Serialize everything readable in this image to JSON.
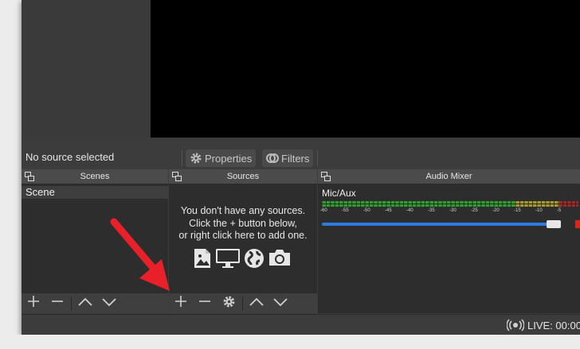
{
  "context_bar": {
    "status": "No source selected",
    "properties_label": "Properties",
    "filters_label": "Filters"
  },
  "docks": {
    "scenes": {
      "title": "Scenes",
      "items": [
        "Scene"
      ]
    },
    "sources": {
      "title": "Sources",
      "empty_line1": "You don't have any sources.",
      "empty_line2": "Click the + button below,",
      "empty_line3": "or right click here to add one."
    },
    "mixer": {
      "title": "Audio Mixer",
      "channel": "Mic/Aux",
      "scale": [
        "-60",
        "-55",
        "-50",
        "-45",
        "-40",
        "-35",
        "-30",
        "-25",
        "-20",
        "-15",
        "-10",
        "-5"
      ],
      "volume_level": 0.97
    }
  },
  "status_bar": {
    "live": "LIVE: 00:00"
  },
  "colors": {
    "annotation_arrow": "#e8202a",
    "slider": "#2f7be0",
    "meter_green": "#2f9e2f",
    "meter_yellow": "#a69a28",
    "meter_red": "#a02828"
  },
  "icons": {
    "undock": "undock-icon",
    "gear": "gear-icon",
    "filters": "filters-icon",
    "add": "plus-icon",
    "remove": "minus-icon",
    "up": "chevron-up-icon",
    "down": "chevron-down-icon",
    "image": "image-icon",
    "display": "monitor-icon",
    "browser": "globe-icon",
    "camera": "camera-icon",
    "live": "broadcast-icon"
  }
}
